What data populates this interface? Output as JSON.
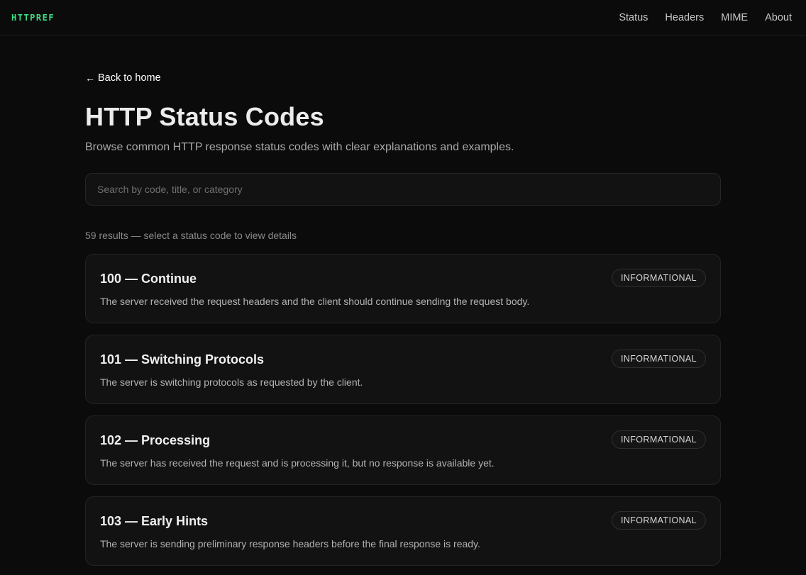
{
  "header": {
    "logo": "HTTPREF",
    "nav": [
      "Status",
      "Headers",
      "MIME",
      "About"
    ]
  },
  "back_link": "Back to home",
  "page_title": "HTTP Status Codes",
  "subtitle": "Browse common HTTP response status codes with clear explanations and examples.",
  "search": {
    "placeholder": "Search by code, title, or category",
    "value": ""
  },
  "results_text": "59 results — select a status code to view details",
  "codes": [
    {
      "title": "100 — Continue",
      "badge": "INFORMATIONAL",
      "description": "The server received the request headers and the client should continue sending the request body."
    },
    {
      "title": "101 — Switching Protocols",
      "badge": "INFORMATIONAL",
      "description": "The server is switching protocols as requested by the client."
    },
    {
      "title": "102 — Processing",
      "badge": "INFORMATIONAL",
      "description": "The server has received the request and is processing it, but no response is available yet."
    },
    {
      "title": "103 — Early Hints",
      "badge": "INFORMATIONAL",
      "description": "The server is sending preliminary response headers before the final response is ready."
    }
  ],
  "colors": {
    "background": "#0b0b0b",
    "accent": "#3ddc84",
    "card": "#121212"
  }
}
